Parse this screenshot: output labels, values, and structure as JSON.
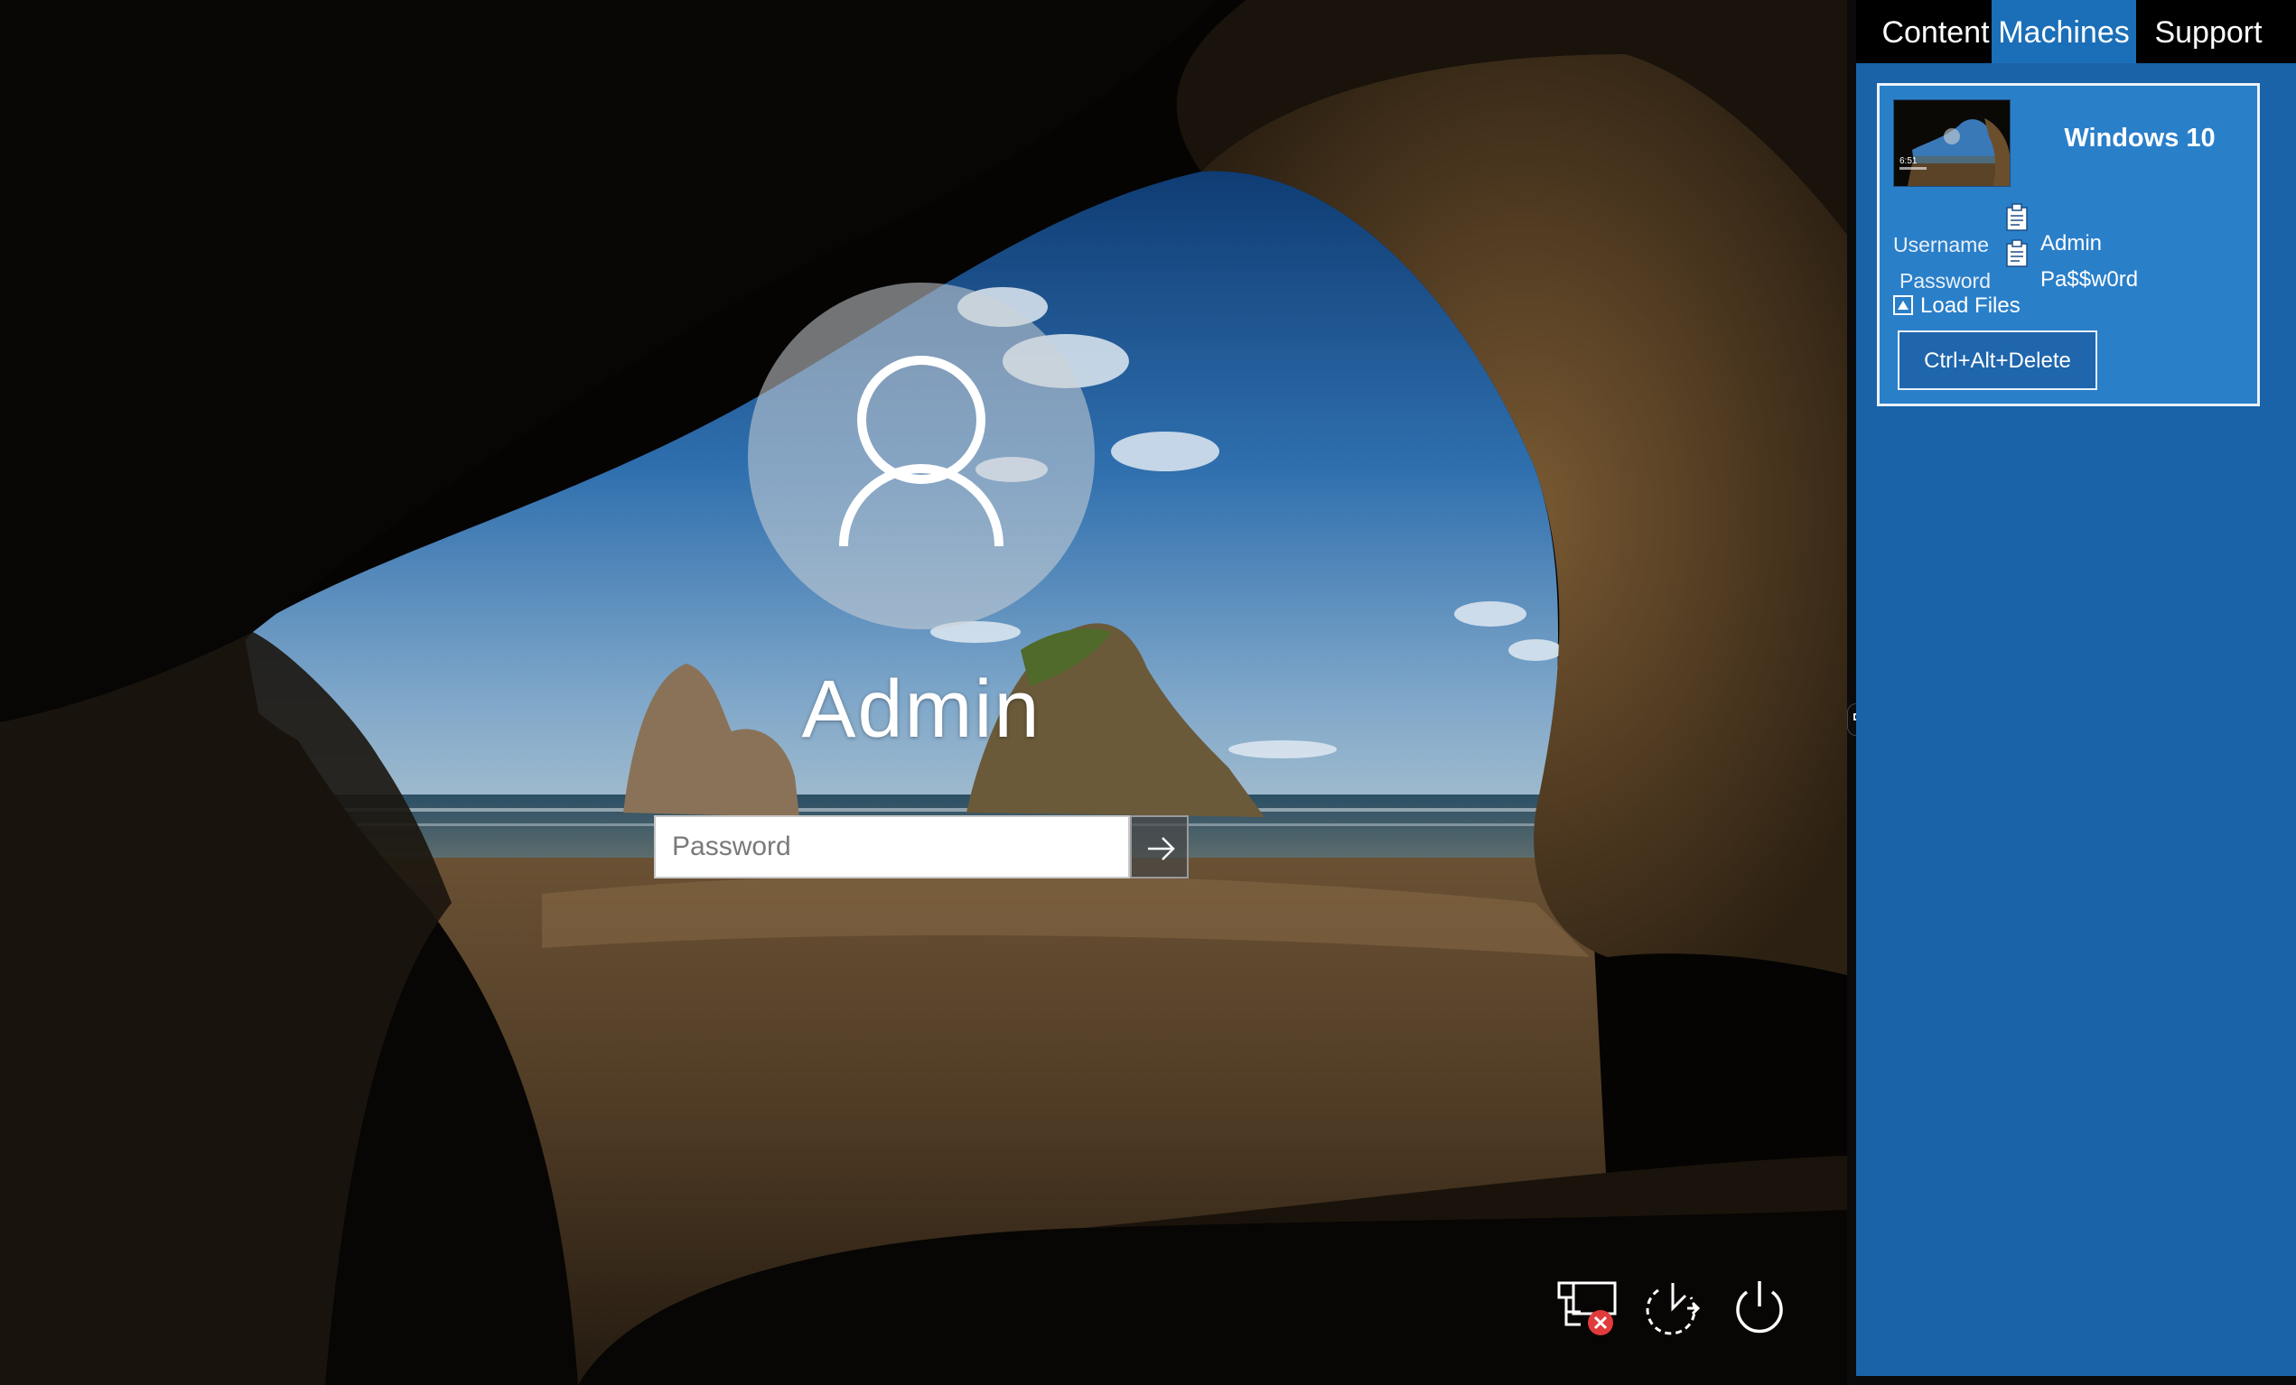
{
  "login": {
    "user_name": "Admin",
    "password_placeholder": "Password"
  },
  "system_icons": [
    "network-disconnected-icon",
    "ease-of-access-icon",
    "power-icon"
  ],
  "panel": {
    "tabs": [
      {
        "label": "Content",
        "active": false
      },
      {
        "label": "Machines",
        "active": true
      },
      {
        "label": "Support",
        "active": false
      }
    ],
    "machine": {
      "title": "Windows 10",
      "thumbnail_clock": "6:51",
      "username_label": "Username",
      "username_value": "Admin",
      "password_label": "Password",
      "password_value": "Pa$$w0rd",
      "load_files_label": "Load Files",
      "ctrl_alt_delete_label": "Ctrl+Alt+Delete"
    }
  },
  "colors": {
    "panel_bg": "#1b63a8",
    "card_bg": "#2a7fc9",
    "active_tab": "#1b6fb8",
    "tab_bar": "#000000"
  }
}
